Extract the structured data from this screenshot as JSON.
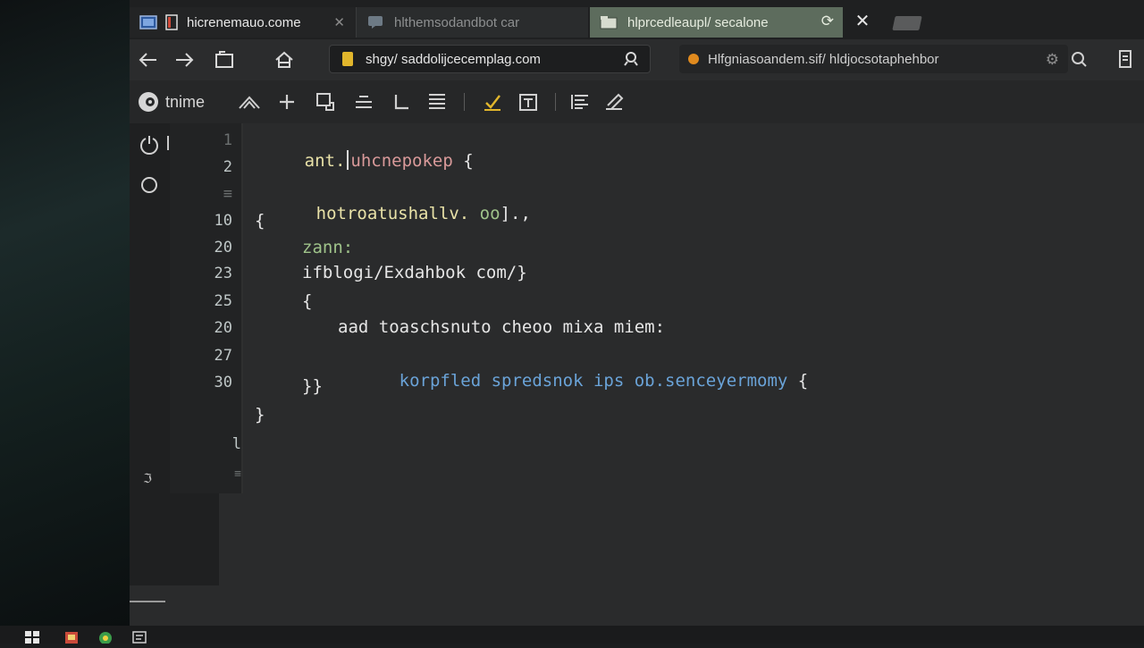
{
  "tabs": [
    {
      "label": "hicrenemauo.come",
      "close": "✕",
      "active": false
    },
    {
      "label": "hlthemsodandbot car",
      "active": false
    },
    {
      "label": "hlprcedleaupl/ secalone",
      "active": true
    }
  ],
  "tabbar": {
    "close_label": "✕"
  },
  "address_bar": {
    "url": "shgy/ saddolijcecemplag.com"
  },
  "secondary_bar": {
    "url": "Hlfgniasoandem.sif/ hldjocsotaphehbor"
  },
  "editor": {
    "brand": "tnime",
    "line_numbers": [
      "1",
      "2",
      "≡",
      "10",
      "20",
      "23",
      "25",
      "20",
      "27",
      "30",
      "l",
      "≡"
    ],
    "rail_bottom_glyph": "ℑ",
    "code": {
      "line1_a": "ant.",
      "line1_b": "uhcnepokep",
      "line1_c": " {",
      "line3_a": "hotroatushallv.",
      "line3_b": " oo",
      "line3_c": "].,",
      "line4": "{",
      "line5": "zann:",
      "line6": "ifblogi/Exdahbok com/}",
      "line7": "{",
      "line8": "aad toaschsnuto cheoo mixa miem:",
      "line9_a": "korpfled spredsnok ips ob.senceyermomy",
      "line9_b": " {",
      "line10": "}}",
      "line11": "}"
    }
  },
  "colors": {
    "accent_tab": "#5d6c5d",
    "lock": "#e1b62c",
    "keyword_yellow": "#e9e2a8",
    "string_blue": "#6aa3d8"
  }
}
